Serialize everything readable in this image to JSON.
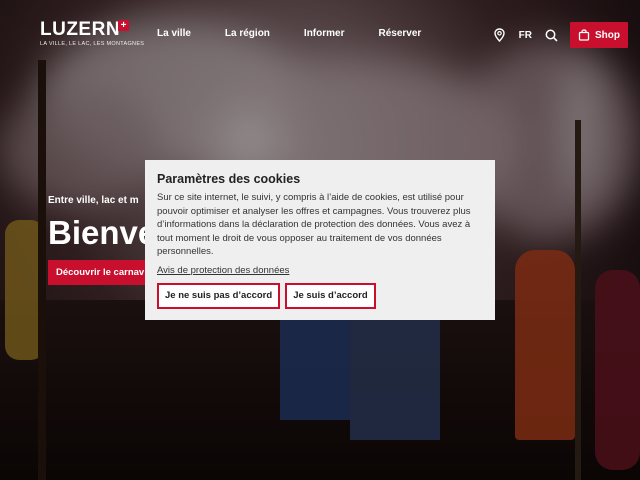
{
  "brand": {
    "name": "LUZERN",
    "tagline": "LA VILLE, LE LAC, LES MONTAGNES",
    "accent_color": "#c8102e"
  },
  "nav": {
    "items": [
      {
        "label": "La ville"
      },
      {
        "label": "La région"
      },
      {
        "label": "Informer"
      },
      {
        "label": "Réserver"
      }
    ]
  },
  "utility": {
    "location_icon": "map-pin-icon",
    "language": "FR",
    "search_icon": "search-icon",
    "shop_icon": "shopping-bag-icon",
    "shop_label": "Shop"
  },
  "hero": {
    "subtitle": "Entre ville, lac et m",
    "title": "Bienve",
    "cta_label": "Découvrir le carnav"
  },
  "cookie_modal": {
    "title": "Paramètres des cookies",
    "body": "Sur ce site internet, le suivi, y compris à l’aide de cookies, est utilisé pour pouvoir optimiser et analyser les offres et campagnes. Vous trouverez plus d’informations dans la déclaration de protection des données. Vous avez à tout moment le droit de vous opposer au traitement de vos données personnelles.",
    "privacy_link": "Avis de protection des données",
    "decline_label": "Je ne suis pas d’accord",
    "accept_label": "Je suis d’accord"
  }
}
